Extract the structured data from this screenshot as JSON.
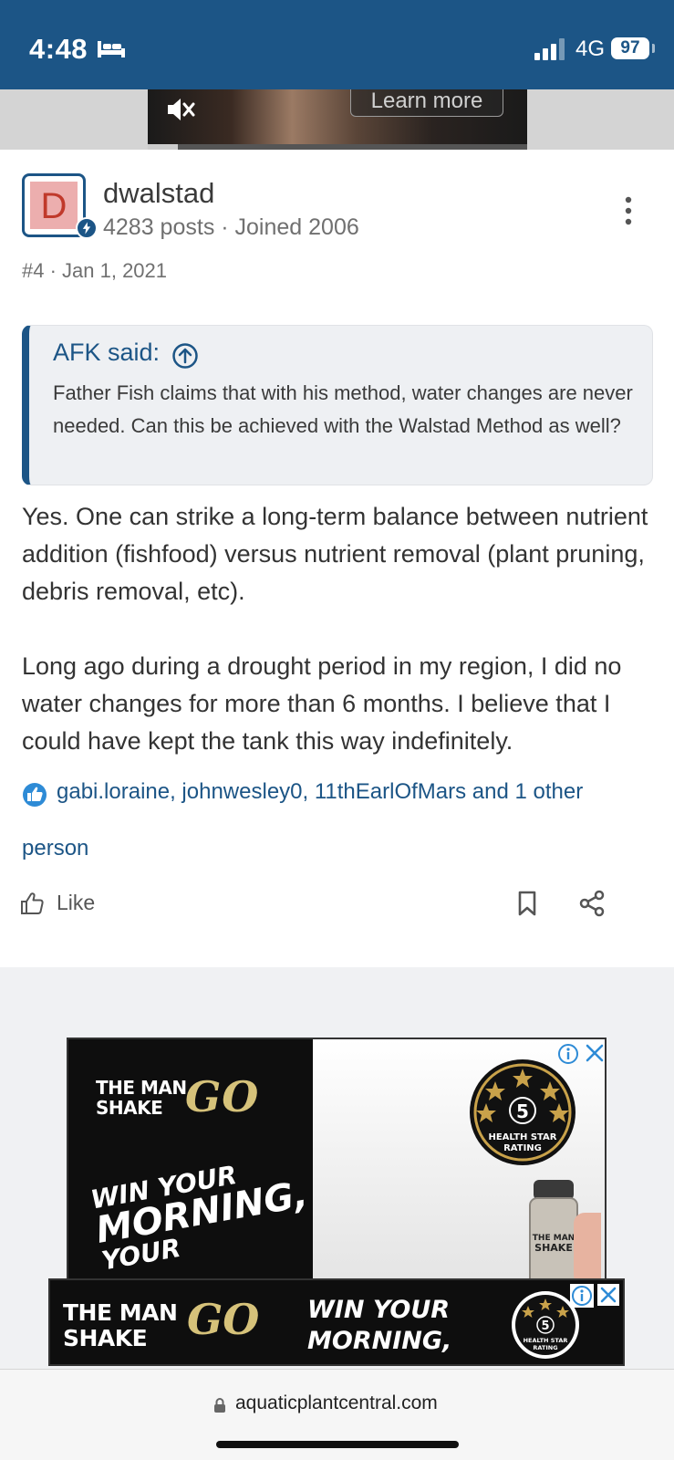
{
  "status_bar": {
    "time": "4:48",
    "network": "4G",
    "battery": "97"
  },
  "top_ad": {
    "learn_more": "Learn more",
    "video_progress": 0.08
  },
  "post": {
    "avatar_letter": "D",
    "username": "dwalstad",
    "meta": "4283 posts · Joined 2006",
    "post_number": "#4 · Jan 1, 2021",
    "quote": {
      "author": "AFK said:",
      "text": "Father Fish claims that with his method, water changes are never needed. Can this be achieved with the Walstad Method as well?"
    },
    "body": [
      "Yes. One can strike a long-term balance between nutrient addition (fishfood) versus nutrient removal (plant pruning, debris removal, etc).",
      "Long ago during a drought period in my region, I did no water changes for more than 6 months. I believe that I could have kept the tank this way indefinitely."
    ],
    "likes_line1": "gabi.loraine, johnwesley0, 11thEarlOfMars and 1 other",
    "likes_line2": "person",
    "like_label": "Like"
  },
  "ad_main": {
    "brand_line1": "THE MAN",
    "brand_line2": "SHAKE",
    "brand_go": "GO",
    "slogan_line1": "WIN YOUR",
    "slogan_line2": "MORNING,",
    "slogan_line3": "YOUR",
    "rating_value": "5",
    "rating_label1": "HEALTH STAR",
    "rating_label2": "RATING",
    "shaker_line1": "THE MAN",
    "shaker_line2": "SHAKE"
  },
  "ad_sticky": {
    "brand_line1": "THE MAN",
    "brand_line2": "SHAKE",
    "brand_go": "GO",
    "slogan_line1": "WIN YOUR",
    "slogan_line2": "MORNING,",
    "rating_value": "5",
    "rating_label1": "HEALTH STAR",
    "rating_label2": "RATING"
  },
  "browser": {
    "url": "aquaticplantcentral.com"
  },
  "colors": {
    "brand_blue": "#1c5586",
    "ad_gold": "#d6c27a",
    "avatar_bg": "#ecaeae",
    "avatar_letter": "#c0392b"
  }
}
